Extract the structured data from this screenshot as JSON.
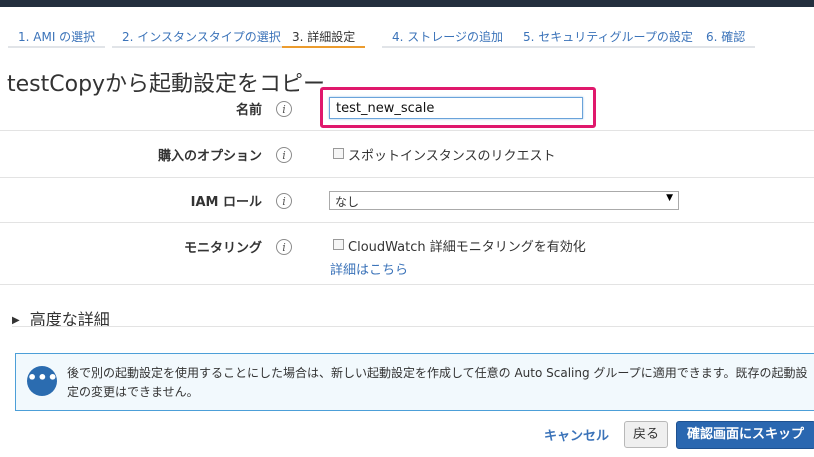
{
  "steps": [
    {
      "label": "1. AMI の選択",
      "active": false
    },
    {
      "label": "2. インスタンスタイプの選択",
      "active": false
    },
    {
      "label": "3. 詳細設定",
      "active": true
    },
    {
      "label": "4. ストレージの追加",
      "active": false
    },
    {
      "label": "5. セキュリティグループの設定",
      "active": false
    },
    {
      "label": "6. 確認",
      "active": false
    }
  ],
  "page_title": "testCopyから起動設定をコピー",
  "form": {
    "name": {
      "label": "名前",
      "value": "test_new_scale"
    },
    "purchase": {
      "label": "購入のオプション",
      "checkbox_label": "スポットインスタンスのリクエスト",
      "checked": false
    },
    "iam": {
      "label": "IAM ロール",
      "selected": "なし"
    },
    "monitoring": {
      "label": "モニタリング",
      "checkbox_label": "CloudWatch 詳細モニタリングを有効化",
      "checked": false,
      "link": "詳細はこちら"
    },
    "info_glyph": "i"
  },
  "advanced": {
    "label": "高度な詳細"
  },
  "notice": {
    "icon": "chat-bubble-icon",
    "text": "後で別の起動設定を使用することにした場合は、新しい起動設定を作成して任意の Auto Scaling グループに適用できます。既存の起動設定の変更はできません。",
    "icon_glyph": "•••"
  },
  "buttons": {
    "cancel": "キャンセル",
    "back": "戻る",
    "skip": "確認画面にスキップ"
  },
  "colors": {
    "accent": "#ec9c2e",
    "link": "#3b73b9",
    "highlight": "#e0186c",
    "primary": "#2a67b0"
  }
}
